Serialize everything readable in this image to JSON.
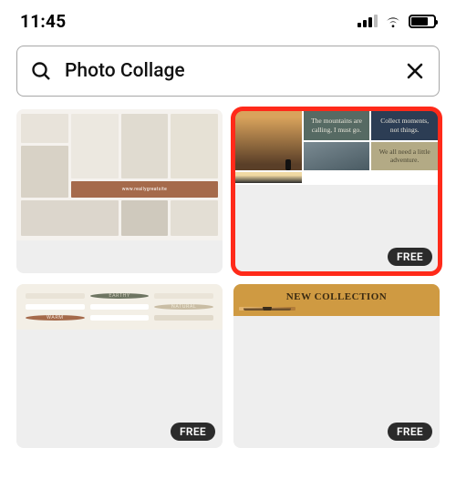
{
  "status_bar": {
    "time": "11:45"
  },
  "search": {
    "value": "Photo Collage"
  },
  "templates": [
    {
      "id": "interior-collage",
      "watermark": "www.reallygreatsite",
      "badge": null,
      "highlighted": false
    },
    {
      "id": "mountain-quotes",
      "quotes": {
        "left": "The mountains are calling, I must go.",
        "right": "Collect moments, not things.",
        "bottom": "We all need a little adventure."
      },
      "badge": "FREE",
      "highlighted": true
    },
    {
      "id": "earthy-grid",
      "circle_labels": [
        "EARTHY",
        "NATURAL",
        "WARM"
      ],
      "badge": "FREE",
      "highlighted": false
    },
    {
      "id": "new-collection",
      "title": "NEW COLLECTION",
      "badge": "FREE",
      "highlighted": false
    }
  ]
}
